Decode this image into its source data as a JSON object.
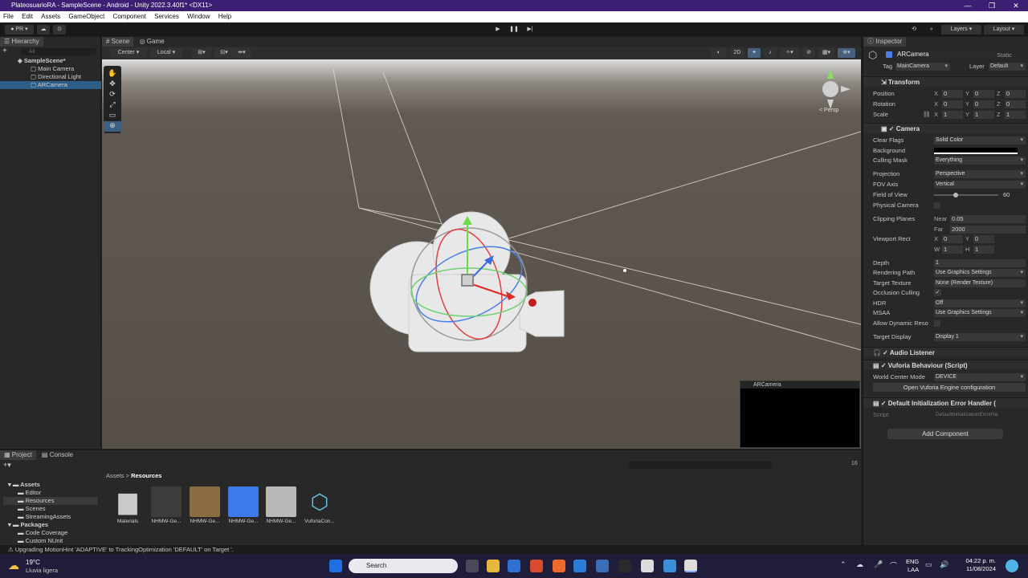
{
  "window": {
    "title": "PlateosuarioRA - SampleScene - Android - Unity 2022.3.40f1* <DX11>"
  },
  "menu": [
    "File",
    "Edit",
    "Assets",
    "GameObject",
    "Component",
    "Services",
    "Window",
    "Help"
  ],
  "toolbar": {
    "account": "PR",
    "layers": "Layers",
    "layout": "Layout"
  },
  "hierarchy": {
    "tab": "Hierarchy",
    "search_placeholder": "All",
    "scene": "SampleScene*",
    "items": [
      "Main Camera",
      "Directional Light",
      "ARCamera"
    ]
  },
  "scene_view": {
    "tabs": [
      "Scene",
      "Game"
    ],
    "pivot": "Center",
    "space": "Local",
    "mode_2d": "2D",
    "persp_label": "< Persp",
    "preview_title": "ARCamera"
  },
  "inspector": {
    "tab": "Inspector",
    "object_name": "ARCamera",
    "static_label": "Static",
    "tag_label": "Tag",
    "tag_value": "MainCamera",
    "layer_label": "Layer",
    "layer_value": "Default",
    "transform": {
      "title": "Transform",
      "position": {
        "label": "Position",
        "x": "0",
        "y": "0",
        "z": "0"
      },
      "rotation": {
        "label": "Rotation",
        "x": "0",
        "y": "0",
        "z": "0"
      },
      "scale": {
        "label": "Scale",
        "x": "1",
        "y": "1",
        "z": "1"
      }
    },
    "camera": {
      "title": "Camera",
      "clear_flags": {
        "label": "Clear Flags",
        "value": "Solid Color"
      },
      "background": {
        "label": "Background"
      },
      "culling_mask": {
        "label": "Culling Mask",
        "value": "Everything"
      },
      "projection": {
        "label": "Projection",
        "value": "Perspective"
      },
      "fov_axis": {
        "label": "FOV Axis",
        "value": "Vertical"
      },
      "field_of_view": {
        "label": "Field of View",
        "value": "60"
      },
      "physical_camera": {
        "label": "Physical Camera"
      },
      "clipping": {
        "label": "Clipping Planes",
        "near_label": "Near",
        "near": "0.05",
        "far_label": "Far",
        "far": "2000"
      },
      "viewport": {
        "label": "Viewport Rect",
        "x": "0",
        "y": "0",
        "w": "1",
        "h": "1"
      },
      "depth": {
        "label": "Depth",
        "value": "1"
      },
      "rendering_path": {
        "label": "Rendering Path",
        "value": "Use Graphics Settings"
      },
      "target_texture": {
        "label": "Target Texture",
        "value": "None (Render Texture)"
      },
      "occlusion": {
        "label": "Occlusion Culling",
        "value": "✓"
      },
      "hdr": {
        "label": "HDR",
        "value": "Off"
      },
      "msaa": {
        "label": "MSAA",
        "value": "Use Graphics Settings"
      },
      "dynamic_res": {
        "label": "Allow Dynamic Reso"
      },
      "target_display": {
        "label": "Target Display",
        "value": "Display 1"
      }
    },
    "audio_listener": "Audio Listener",
    "vuforia": {
      "title": "Vuforia Behaviour (Script)",
      "world_center_label": "World Center Mode",
      "world_center_value": "DEVICE",
      "open_button": "Open Vuforia Engine configuration"
    },
    "error_handler": {
      "title": "Default Initialization Error Handler (",
      "script_label": "Script",
      "script_value": "DefaultInitializationErrorHa"
    },
    "add_component": "Add Component"
  },
  "project": {
    "tabs": [
      "Project",
      "Console"
    ],
    "breadcrumb": [
      "Assets",
      "Resources"
    ],
    "tree": [
      "Assets",
      "Editor",
      "Resources",
      "Scenes",
      "StreamingAssets",
      "Packages",
      "Code Coverage",
      "Custom NUnit"
    ],
    "assets": [
      "Materials",
      "NHMW-Ge...",
      "NHMW-Ge...",
      "NHMW-Ge...",
      "NHMW-Ge...",
      "VuforiaCon..."
    ],
    "count": "16"
  },
  "status": {
    "message": "Upgrading MotionHint 'ADAPTIVE' to TrackingOptimization 'DEFAULT' on Target '."
  },
  "taskbar": {
    "temp": "19°C",
    "weather": "Lluvia ligera",
    "search": "Search",
    "lang1": "ENG",
    "lang2": "LAA",
    "time": "04:22 p. m.",
    "date": "11/08/2024"
  },
  "colors": {
    "title_bar": "#3c1f73",
    "scene_bg": "#565049",
    "panel": "#282828",
    "accent_blue": "#4a7ee8",
    "taskbar": "#1f1d3a"
  }
}
